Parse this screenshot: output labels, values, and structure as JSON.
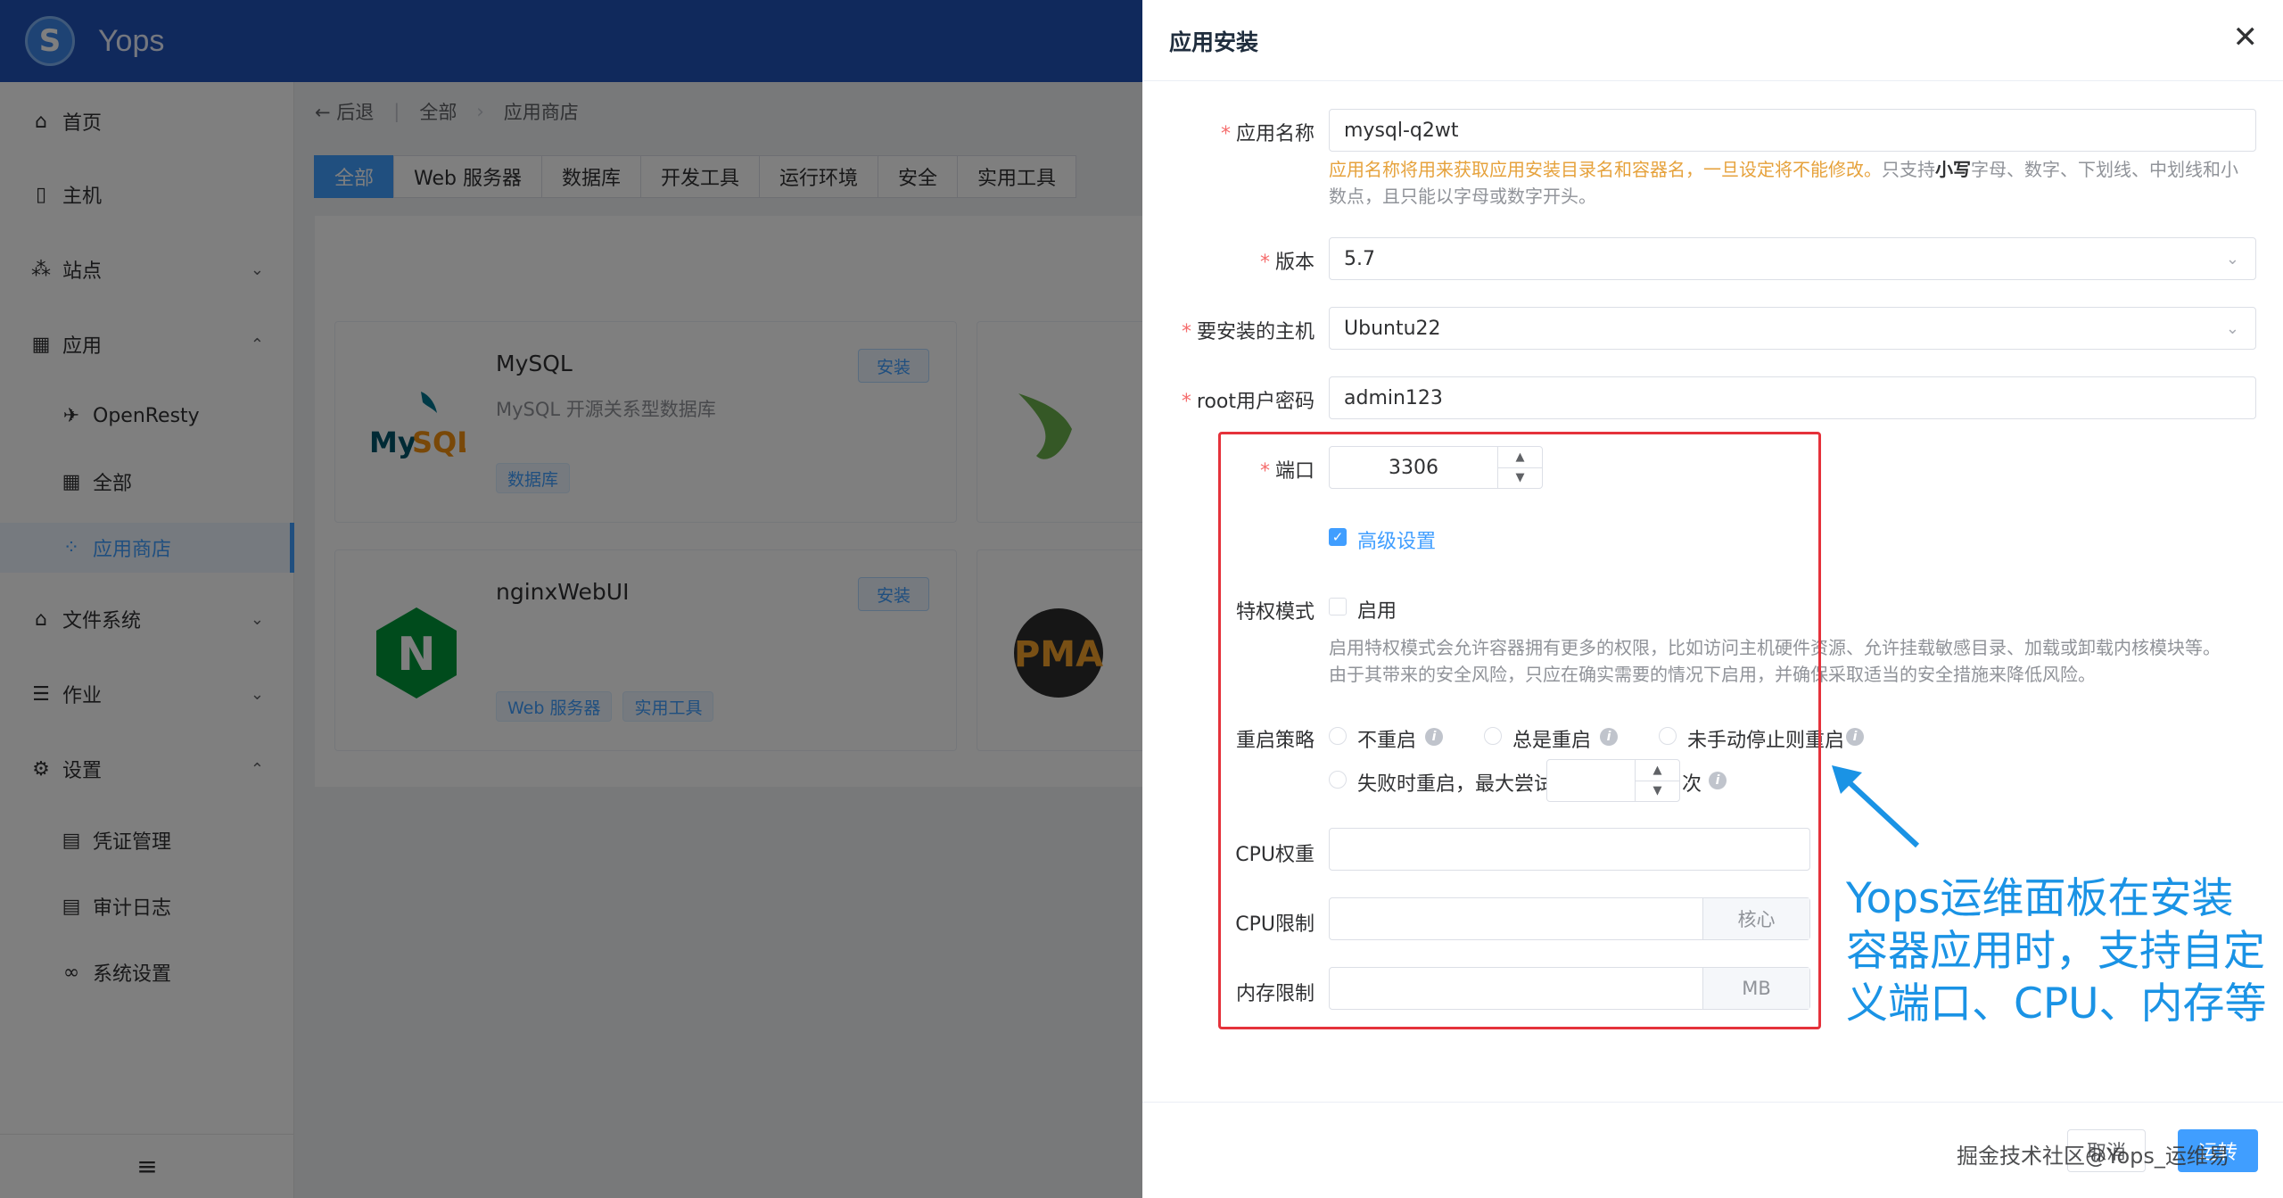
{
  "app": {
    "brand": "Yops",
    "logo_letter": "S"
  },
  "sidebar": {
    "items": [
      {
        "label": "首页",
        "icon": "home-icon"
      },
      {
        "label": "主机",
        "icon": "host-icon"
      },
      {
        "label": "站点",
        "icon": "site-icon"
      },
      {
        "label": "应用",
        "icon": "apps-icon"
      },
      {
        "label": "OpenResty",
        "icon": "openresty-icon"
      },
      {
        "label": "全部",
        "icon": "grid-icon"
      },
      {
        "label": "应用商店",
        "icon": "store-icon"
      },
      {
        "label": "文件系统",
        "icon": "filesystem-icon"
      },
      {
        "label": "作业",
        "icon": "job-icon"
      },
      {
        "label": "设置",
        "icon": "gear-icon"
      },
      {
        "label": "凭证管理",
        "icon": "credential-icon"
      },
      {
        "label": "审计日志",
        "icon": "audit-icon"
      },
      {
        "label": "系统设置",
        "icon": "system-icon"
      }
    ]
  },
  "breadcrumb": {
    "back": "后退",
    "root": "全部",
    "current": "应用商店"
  },
  "tabs": [
    "全部",
    "Web 服务器",
    "数据库",
    "开发工具",
    "运行环境",
    "安全",
    "实用工具"
  ],
  "cards": [
    {
      "title": "MySQL",
      "desc": "MySQL 开源关系型数据库",
      "button": "安装",
      "tags": [
        "数据库"
      ],
      "logo_text": "MySQL"
    },
    {
      "title": "nginxWebUI",
      "desc": "",
      "button": "安装",
      "tags": [
        "Web 服务器",
        "实用工具"
      ],
      "logo_text": "N"
    }
  ],
  "partial_logo": "PMA",
  "drawer": {
    "title": "应用安装",
    "fields": {
      "app_name": {
        "label": "应用名称",
        "value": "mysql-q2wt"
      },
      "app_name_hint_warn": "应用名称将用来获取应用安装目录名和容器名，一旦设定将不能修改。",
      "app_name_hint_pre": "只支持",
      "app_name_hint_bold": "小写",
      "app_name_hint_post": "字母、数字、下划线、中划线和小",
      "app_name_hint_line2": "数点，且只能以字母或数字开头。",
      "version": {
        "label": "版本",
        "value": "5.7"
      },
      "host": {
        "label": "要安装的主机",
        "value": "Ubuntu22"
      },
      "root_password": {
        "label": "root用户密码",
        "value": "admin123"
      },
      "port": {
        "label": "端口",
        "value": "3306"
      },
      "advanced": {
        "label": "高级设置",
        "checked": true
      },
      "privileged": {
        "label": "特权模式",
        "option": "启用",
        "checked": false
      },
      "privileged_hint_1": "启用特权模式会允许容器拥有更多的权限，比如访问主机硬件资源、允许挂载敏感目录、加载或卸载内核模块等。",
      "privileged_hint_2": "由于其带来的安全风险，只应在确实需要的情况下启用，并确保采取适当的安全措施来降低风险。",
      "restart": {
        "label": "重启策略",
        "options": [
          "不重启",
          "总是重启",
          "未手动停止则重启",
          "失败时重启，最大尝试"
        ],
        "times_suffix": "次"
      },
      "cpu_weight": {
        "label": "CPU权重",
        "value": ""
      },
      "cpu_limit": {
        "label": "CPU限制",
        "value": "",
        "unit": "核心"
      },
      "memory_limit": {
        "label": "内存限制",
        "value": "",
        "unit": "MB"
      }
    },
    "cancel": "取消",
    "confirm": "运转"
  },
  "annotation": "Yops运维面板在安装容器应用时，支持自定义端口、CPU、内存等",
  "watermark": "掘金技术社区@Yops_运维易",
  "colors": {
    "primary": "#409eff",
    "header": "#2153b8",
    "annotation_box": "#e5323b",
    "annotation_text": "#1a93e5"
  }
}
